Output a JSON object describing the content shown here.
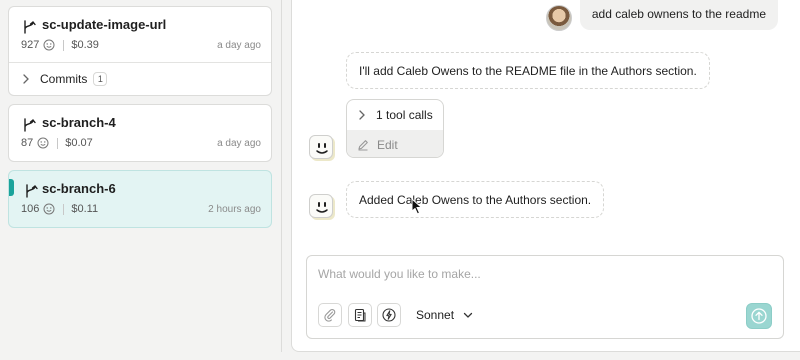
{
  "sidebar": {
    "branches": [
      {
        "name": "sc-update-image-url",
        "count": "927",
        "cost": "$0.39",
        "time": "a day ago",
        "commits_label": "Commits",
        "commits_count": "1"
      },
      {
        "name": "sc-branch-4",
        "count": "87",
        "cost": "$0.07",
        "time": "a day ago"
      },
      {
        "name": "sc-branch-6",
        "count": "106",
        "cost": "$0.11",
        "time": "2 hours ago",
        "active": true
      }
    ]
  },
  "chat": {
    "user_message": "add caleb ownens to the readme",
    "assistant_message_1": "I'll add Caleb Owens to the README file in the Authors section.",
    "tool_calls_label": "1 tool calls",
    "tool_edit_label": "Edit",
    "assistant_message_2": "Added Caleb Owens to the Authors section."
  },
  "composer": {
    "placeholder": "What would you like to make...",
    "model_label": "Sonnet"
  },
  "colors": {
    "accent": "#1aa39b",
    "active_card_bg": "#e3f4f3",
    "send_button": "#9ad6d1"
  },
  "icons": [
    "branch-icon",
    "smiley-icon",
    "chevron-right-icon",
    "pencil-icon",
    "bot-face-icon",
    "paperclip-icon",
    "document-icon",
    "lightning-icon",
    "chevron-down-icon",
    "send-arrow-icon",
    "mouse-cursor-icon",
    "user-avatar"
  ]
}
